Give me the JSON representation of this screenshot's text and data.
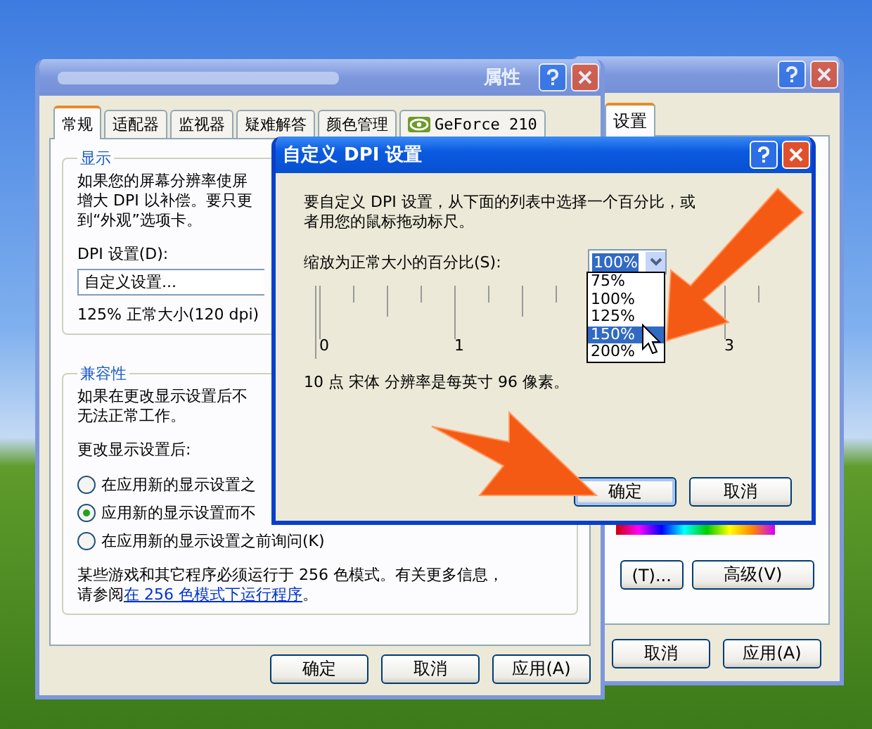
{
  "settings_window": {
    "tab": {
      "label": "设置",
      "selected": true
    },
    "buttons": [
      {
        "label": "(T)..."
      },
      {
        "label": "高级(V)"
      }
    ],
    "footer_buttons": [
      "取消",
      "应用(A)"
    ]
  },
  "properties_window": {
    "title": "属性",
    "tabs": [
      {
        "label": "常规",
        "selected": true
      },
      {
        "label": "适配器",
        "selected": false
      },
      {
        "label": "监视器",
        "selected": false
      },
      {
        "label": "疑难解答",
        "selected": false
      },
      {
        "label": "颜色管理",
        "selected": false
      },
      {
        "label": "GeForce 210",
        "selected": false,
        "kind": "icon"
      }
    ],
    "display_group": {
      "title": "显示",
      "lines": [
        "如果您的屏幕分辨率使屏",
        "增大 DPI 以补偿。要只更",
        "到“外观”选项卡。"
      ],
      "dpi_label": "DPI 设置(D):",
      "dpi_value": "自定义设置...",
      "dpi_info": "125% 正常大小(120 dpi)"
    },
    "compat_group": {
      "title": "兼容性",
      "lines": [
        "如果在更改显示设置后不",
        "无法正常工作。"
      ],
      "prompt": "更改显示设置后:",
      "options": [
        {
          "label": "在应用新的显示设置之",
          "selected": false
        },
        {
          "label": "应用新的显示设置而不",
          "selected": true
        },
        {
          "label": "在应用新的显示设置之前询问(K)",
          "selected": false
        }
      ],
      "note": "某些游戏和其它程序必须运行于 256 色模式。有关更多信息，",
      "note_prefix": "请参阅",
      "link": "在 256 色模式下运行程序",
      "note_suffix": "。"
    },
    "buttons": [
      "确定",
      "取消",
      "应用(A)"
    ]
  },
  "dpi_dialog": {
    "title": "自定义 DPI 设置",
    "instruction": [
      "要自定义 DPI 设置，从下面的列表中选择一个百分比，或",
      "者用您的鼠标拖动标尺。"
    ],
    "scale_label": "缩放为正常大小的百分比(S):",
    "combo": {
      "value": "100%",
      "options": [
        {
          "label": "75%",
          "highlighted": false
        },
        {
          "label": "100%",
          "highlighted": false
        },
        {
          "label": "125%",
          "highlighted": false
        },
        {
          "label": "150%",
          "highlighted": true
        },
        {
          "label": "200%",
          "highlighted": false
        }
      ]
    },
    "ruler_labels": [
      "0",
      "1",
      "3"
    ],
    "font_info": "10 点 宋体 分辨率是每英寸 96 像素。",
    "buttons": [
      {
        "label": "确定",
        "focused": true
      },
      {
        "label": "取消",
        "focused": false
      }
    ]
  }
}
